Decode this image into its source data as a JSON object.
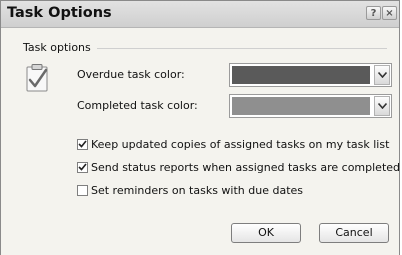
{
  "window": {
    "title": "Task Options",
    "help_glyph": "?",
    "close_glyph": "×"
  },
  "group": {
    "label": "Task options",
    "icon": "task-checklist-icon"
  },
  "fields": {
    "overdue": {
      "label": "Overdue task color:",
      "color": "#5a5a5a"
    },
    "completed": {
      "label": "Completed task color:",
      "color": "#8f8f8f"
    }
  },
  "checkboxes": [
    {
      "label": "Keep updated copies of assigned tasks on my task list",
      "checked": true
    },
    {
      "label": "Send status reports when assigned tasks are completed",
      "checked": true
    },
    {
      "label": "Set reminders on tasks with due dates",
      "checked": false
    }
  ],
  "buttons": {
    "ok": "OK",
    "cancel": "Cancel"
  }
}
